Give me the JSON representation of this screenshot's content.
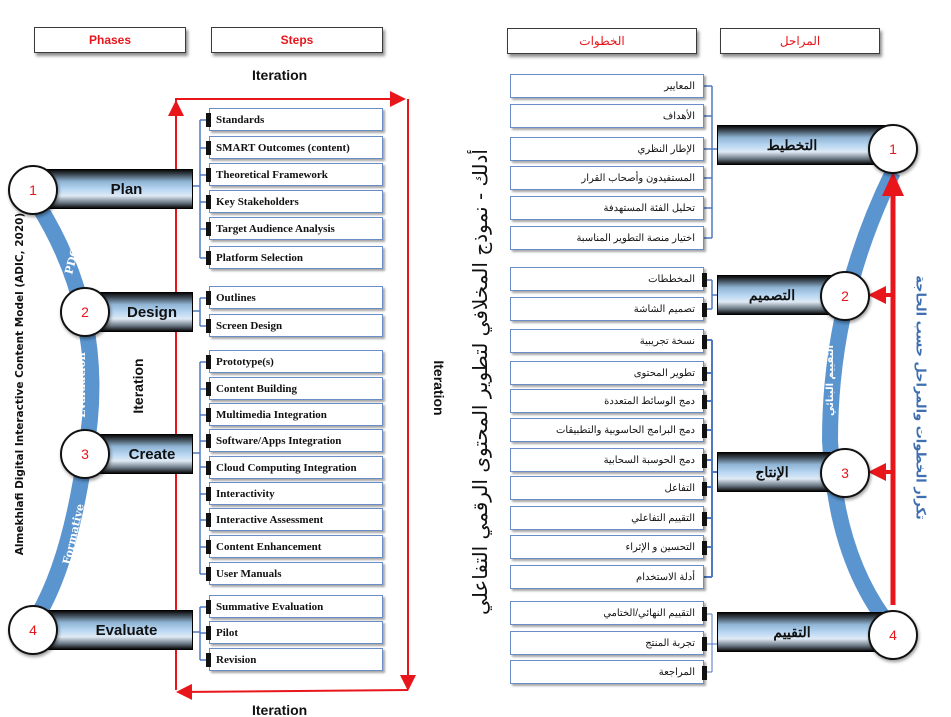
{
  "english": {
    "headers": {
      "phases": "Phases",
      "steps": "Steps"
    },
    "model_title": "Almekhlafi Digital Interactive Content Model (ADIC, 2020)",
    "iteration_top": "Iteration",
    "iteration_bottom": "Iteration",
    "iteration_right": "Iteration",
    "iteration_left": "Iteration",
    "arc_labels": [
      "PDCE",
      "Evaluation",
      "Formative"
    ],
    "phases": [
      {
        "number": "1",
        "label": "Plan"
      },
      {
        "number": "2",
        "label": "Design"
      },
      {
        "number": "3",
        "label": "Create"
      },
      {
        "number": "4",
        "label": "Evaluate"
      }
    ],
    "steps": {
      "plan": [
        "Standards",
        "SMART Outcomes (content)",
        "Theoretical Framework",
        "Key Stakeholders",
        "Target Audience Analysis",
        "Platform Selection"
      ],
      "design": [
        "Outlines",
        "Screen Design"
      ],
      "create": [
        "Prototype(s)",
        "Content Building",
        "Multimedia Integration",
        "Software/Apps Integration",
        "Cloud Computing Integration",
        "Interactivity",
        "Interactive Assessment",
        "Content Enhancement",
        "User Manuals"
      ],
      "evaluate": [
        "Summative Evaluation",
        "Pilot",
        "Revision"
      ]
    }
  },
  "arabic": {
    "headers": {
      "steps": "الخطوات",
      "phases": "المراحل"
    },
    "model_title": "أدلك - نموذج المخلافي لتطوير المحتوى الرقمي التفاعلي",
    "arc_label": "التقييم البنائي",
    "iteration_note": "تكرار الخطوات والمراحل حسب الحاجة",
    "phases": [
      {
        "number": "1",
        "label": "التخطيط"
      },
      {
        "number": "2",
        "label": "التصميم"
      },
      {
        "number": "3",
        "label": "الإنتاج"
      },
      {
        "number": "4",
        "label": "التقييم"
      }
    ],
    "steps": {
      "plan": [
        "المعايير",
        "الأهداف",
        "الإطار النظري",
        "المستفيدون وأصحاب القرار",
        "تحليل الفئة المستهدفة",
        "اختيار منصة التطوير المناسبة"
      ],
      "design": [
        "المخططات",
        "تصميم الشاشة"
      ],
      "create": [
        "نسخة تجريبية",
        "تطوير المحتوى",
        "دمج الوسائط المتعددة",
        "دمج البرامج الحاسوبية والتطبيقات",
        "دمج الحوسبة السحابية",
        "التفاعل",
        "التقييم التفاعلي",
        "التحسين و الإثراء",
        "أدلة الاستخدام"
      ],
      "evaluate": [
        "التقييم النهائي/الختامي",
        "تجربة المنتج",
        "المراجعة"
      ]
    }
  },
  "colors": {
    "accent_red": "#e8161b",
    "arc_blue": "#5b95cf",
    "connector_blue": "#4f78c0",
    "note_blue": "#3f6fb0"
  }
}
